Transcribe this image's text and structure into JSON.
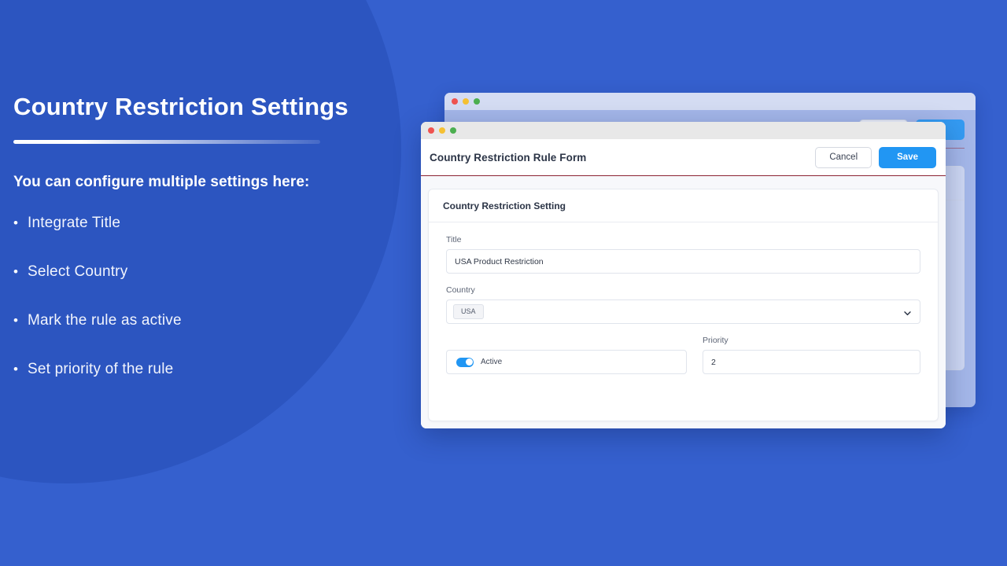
{
  "theme": {
    "background_blue": "#3560ce",
    "circle_blue": "#2c55c0",
    "accent_blue": "#2196f3",
    "header_rule_red": "#8c2433"
  },
  "left_panel": {
    "headline": "Country Restriction Settings",
    "subhead": "You can configure multiple settings here:",
    "bullet_symbol": "•",
    "bullets": [
      {
        "label": "Integrate Title"
      },
      {
        "label": "Select Country"
      },
      {
        "label": "Mark the rule as active"
      },
      {
        "label": "Set priority of the rule"
      }
    ]
  },
  "modal": {
    "title": "Country Restriction Rule Form",
    "cancel_label": "Cancel",
    "save_label": "Save",
    "traffic_lights": [
      "close-red",
      "minimize-yellow",
      "maximize-green"
    ],
    "card": {
      "header": "Country Restriction Setting",
      "fields": {
        "title": {
          "label": "Title",
          "value": "USA Product Restriction",
          "placeholder": "Title"
        },
        "country": {
          "label": "Country",
          "selected_chip": "USA",
          "chevron_icon": "chevron-down-icon"
        },
        "active": {
          "label": "Active",
          "state": "on"
        },
        "priority": {
          "label": "Priority",
          "value": "2",
          "placeholder": "Priority"
        }
      }
    }
  }
}
